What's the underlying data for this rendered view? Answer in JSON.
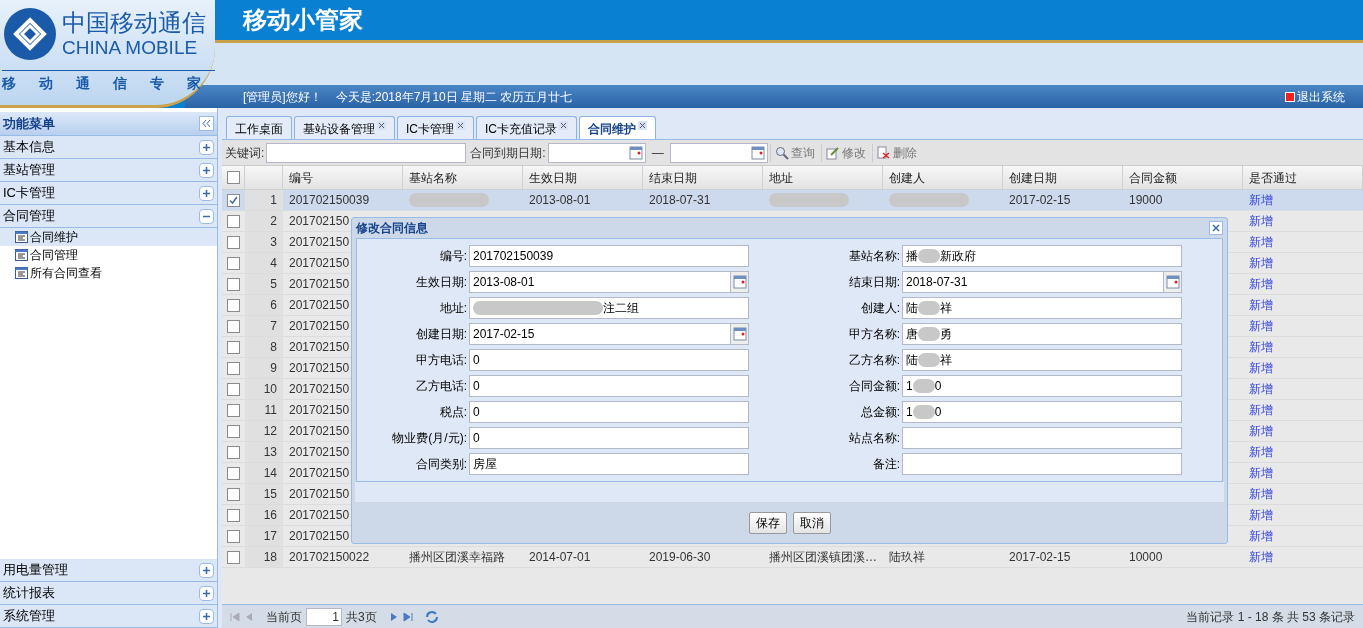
{
  "header": {
    "logo_cn": "中国移动通信",
    "logo_en": "CHINA MOBILE",
    "slogan": [
      "移",
      "动",
      "通",
      "信",
      "专",
      "家"
    ],
    "title": "移动小管家",
    "greeting": "[管理员]您好！",
    "date": "今天是:2018年7月10日 星期二 农历五月廿七",
    "logout": "退出系统"
  },
  "sidebar": {
    "title": "功能菜单",
    "groups": [
      {
        "label": "基本信息",
        "expanded": false
      },
      {
        "label": "基站管理",
        "expanded": false
      },
      {
        "label": "IC卡管理",
        "expanded": false
      },
      {
        "label": "合同管理",
        "expanded": true,
        "children": [
          {
            "label": "合同维护",
            "selected": true
          },
          {
            "label": "合同管理",
            "selected": false
          },
          {
            "label": "所有合同查看",
            "selected": false
          }
        ]
      },
      {
        "label": "用电量管理",
        "expanded": false
      },
      {
        "label": "统计报表",
        "expanded": false
      },
      {
        "label": "系统管理",
        "expanded": false
      }
    ]
  },
  "tabs": [
    {
      "label": "工作桌面",
      "closable": false,
      "selected": false
    },
    {
      "label": "基站设备管理",
      "closable": true,
      "selected": false
    },
    {
      "label": "IC卡管理",
      "closable": true,
      "selected": false
    },
    {
      "label": "IC卡充值记录",
      "closable": true,
      "selected": false
    },
    {
      "label": "合同维护",
      "closable": true,
      "selected": true
    }
  ],
  "toolbar": {
    "keyword_label": "关键词:",
    "date_label": "合同到期日期:",
    "dash": "—",
    "buttons": [
      {
        "kind": "search",
        "label": "查询"
      },
      {
        "kind": "edit",
        "label": "修改"
      },
      {
        "kind": "delete",
        "label": "删除"
      }
    ]
  },
  "table": {
    "select_all_checked": false,
    "columns": [
      "编号",
      "基站名称",
      "生效日期",
      "结束日期",
      "地址",
      "创建人",
      "创建日期",
      "合同金额",
      "是否通过"
    ],
    "rows": [
      {
        "num": "1",
        "checked": true,
        "selected": true,
        "cells": [
          {
            "text": "201702150039"
          },
          {
            "blurred": true
          },
          {
            "text": "2013-08-01"
          },
          {
            "text": "2018-07-31"
          },
          {
            "blurred": true
          },
          {
            "blurred": true
          },
          {
            "text": "2017-02-15"
          },
          {
            "text": "19000"
          }
        ],
        "link": "新增"
      },
      {
        "num": "2",
        "checked": false,
        "selected": false,
        "cells": [
          {
            "text": "201702150"
          }
        ],
        "link": "新增"
      },
      {
        "num": "3",
        "checked": false,
        "selected": false,
        "cells": [
          {
            "text": "201702150"
          }
        ],
        "link": "新增"
      },
      {
        "num": "4",
        "checked": false,
        "selected": false,
        "cells": [
          {
            "text": "201702150"
          }
        ],
        "link": "新增"
      },
      {
        "num": "5",
        "checked": false,
        "selected": false,
        "cells": [
          {
            "text": "201702150"
          }
        ],
        "link": "新增"
      },
      {
        "num": "6",
        "checked": false,
        "selected": false,
        "cells": [
          {
            "text": "201702150"
          }
        ],
        "link": "新增"
      },
      {
        "num": "7",
        "checked": false,
        "selected": false,
        "cells": [
          {
            "text": "201702150"
          }
        ],
        "link": "新增"
      },
      {
        "num": "8",
        "checked": false,
        "selected": false,
        "cells": [
          {
            "text": "201702150"
          }
        ],
        "link": "新增"
      },
      {
        "num": "9",
        "checked": false,
        "selected": false,
        "cells": [
          {
            "text": "201702150"
          }
        ],
        "link": "新增"
      },
      {
        "num": "10",
        "checked": false,
        "selected": false,
        "cells": [
          {
            "text": "201702150"
          }
        ],
        "link": "新增"
      },
      {
        "num": "11",
        "checked": false,
        "selected": false,
        "cells": [
          {
            "text": "201702150"
          }
        ],
        "link": "新增"
      },
      {
        "num": "12",
        "checked": false,
        "selected": false,
        "cells": [
          {
            "text": "201702150"
          }
        ],
        "link": "新增"
      },
      {
        "num": "13",
        "checked": false,
        "selected": false,
        "cells": [
          {
            "text": "201702150"
          }
        ],
        "link": "新增"
      },
      {
        "num": "14",
        "checked": false,
        "selected": false,
        "cells": [
          {
            "text": "201702150"
          }
        ],
        "link": "新增"
      },
      {
        "num": "15",
        "checked": false,
        "selected": false,
        "cells": [
          {
            "text": "201702150"
          }
        ],
        "link": "新增"
      },
      {
        "num": "16",
        "checked": false,
        "selected": false,
        "cells": [
          {
            "text": "201702150"
          }
        ],
        "link": "新增"
      },
      {
        "num": "17",
        "checked": false,
        "selected": false,
        "cells": [
          {
            "text": "201702150"
          }
        ],
        "link": "新增"
      },
      {
        "num": "18",
        "checked": false,
        "selected": false,
        "cells": [
          {
            "text": "201702150022"
          },
          {
            "text": "播州区团溪幸福路"
          },
          {
            "text": "2014-07-01"
          },
          {
            "text": "2019-06-30"
          },
          {
            "text": "播州区团溪镇团溪…"
          },
          {
            "text": "陆玖祥"
          },
          {
            "text": "2017-02-15"
          },
          {
            "text": "10000"
          }
        ],
        "link": "新增"
      }
    ]
  },
  "dialog": {
    "title": "修改合同信息",
    "left": [
      {
        "label": "编号:",
        "kind": "text",
        "value": "201702150039"
      },
      {
        "label": "生效日期:",
        "kind": "date",
        "value": "2013-08-01"
      },
      {
        "label": "地址:",
        "kind": "text",
        "redacted": true,
        "value": "注二组"
      },
      {
        "label": "创建日期:",
        "kind": "date",
        "value": "2017-02-15"
      },
      {
        "label": "甲方电话:",
        "kind": "text",
        "value": "0"
      },
      {
        "label": "乙方电话:",
        "kind": "text",
        "value": "0"
      },
      {
        "label": "税点:",
        "kind": "text",
        "value": "0"
      },
      {
        "label": "物业费(月/元):",
        "kind": "text",
        "value": "0"
      },
      {
        "label": "合同类别:",
        "kind": "text",
        "value": "房屋"
      }
    ],
    "right": [
      {
        "label": "基站名称:",
        "kind": "text",
        "redacted": true,
        "prefix": "播",
        "value": "新政府"
      },
      {
        "label": "结束日期:",
        "kind": "date",
        "value": "2018-07-31"
      },
      {
        "label": "创建人:",
        "kind": "text",
        "redacted": true,
        "prefix": "陆",
        "value": "祥"
      },
      {
        "label": "甲方名称:",
        "kind": "text",
        "redacted": true,
        "prefix": "唐",
        "value": "勇"
      },
      {
        "label": "乙方名称:",
        "kind": "text",
        "redacted": true,
        "prefix": "陆",
        "value": "祥"
      },
      {
        "label": "合同金额:",
        "kind": "text",
        "redacted": true,
        "prefix": "1",
        "value": "0"
      },
      {
        "label": "总金额:",
        "kind": "text",
        "redacted": true,
        "prefix": "1",
        "value": "0"
      },
      {
        "label": "站点名称:",
        "kind": "text"
      },
      {
        "label": "备注:",
        "kind": "text"
      }
    ],
    "buttons": [
      "保存",
      "取消"
    ]
  },
  "pager": {
    "page_label": "当前页",
    "page": "1",
    "total_pages": "共3页",
    "summary": "当前记录 1 - 18 条 共 53 条记录"
  }
}
